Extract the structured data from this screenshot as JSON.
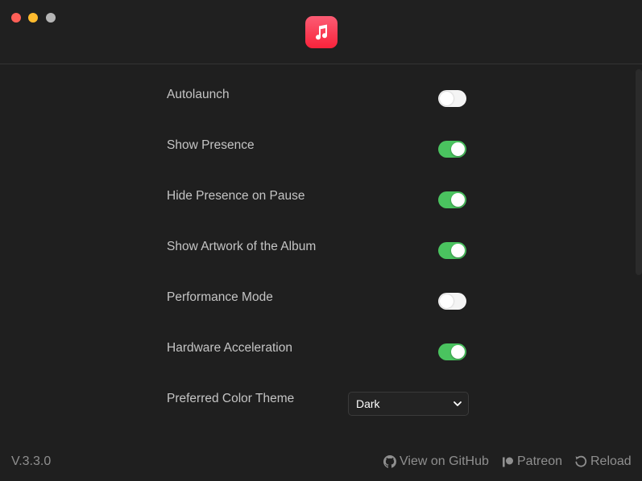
{
  "window": {
    "traffic_lights": [
      "close",
      "minimize",
      "zoom"
    ],
    "app_icon": "music-note-icon"
  },
  "settings": [
    {
      "label": "Autolaunch",
      "enabled": false
    },
    {
      "label": "Show Presence",
      "enabled": true
    },
    {
      "label": "Hide Presence on Pause",
      "enabled": true
    },
    {
      "label": "Show Artwork of the Album",
      "enabled": true
    },
    {
      "label": "Performance Mode",
      "enabled": false
    },
    {
      "label": "Hardware Acceleration",
      "enabled": true
    }
  ],
  "theme": {
    "label": "Preferred Color Theme",
    "selected": "Dark"
  },
  "footer": {
    "version": "V.3.3.0",
    "github_label": "View on GitHub",
    "patreon_label": "Patreon",
    "reload_label": "Reload"
  },
  "colors": {
    "toggle_on": "#4ac35f",
    "toggle_off": "#f4f4f4",
    "app_icon": "#fa2d48"
  }
}
